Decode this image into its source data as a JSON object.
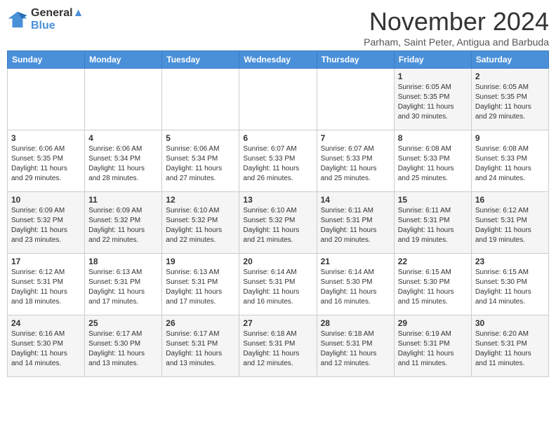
{
  "header": {
    "logo_line1": "General",
    "logo_line2": "Blue",
    "month": "November 2024",
    "location": "Parham, Saint Peter, Antigua and Barbuda"
  },
  "weekdays": [
    "Sunday",
    "Monday",
    "Tuesday",
    "Wednesday",
    "Thursday",
    "Friday",
    "Saturday"
  ],
  "weeks": [
    [
      {
        "day": "",
        "info": ""
      },
      {
        "day": "",
        "info": ""
      },
      {
        "day": "",
        "info": ""
      },
      {
        "day": "",
        "info": ""
      },
      {
        "day": "",
        "info": ""
      },
      {
        "day": "1",
        "info": "Sunrise: 6:05 AM\nSunset: 5:35 PM\nDaylight: 11 hours and 30 minutes."
      },
      {
        "day": "2",
        "info": "Sunrise: 6:05 AM\nSunset: 5:35 PM\nDaylight: 11 hours and 29 minutes."
      }
    ],
    [
      {
        "day": "3",
        "info": "Sunrise: 6:06 AM\nSunset: 5:35 PM\nDaylight: 11 hours and 29 minutes."
      },
      {
        "day": "4",
        "info": "Sunrise: 6:06 AM\nSunset: 5:34 PM\nDaylight: 11 hours and 28 minutes."
      },
      {
        "day": "5",
        "info": "Sunrise: 6:06 AM\nSunset: 5:34 PM\nDaylight: 11 hours and 27 minutes."
      },
      {
        "day": "6",
        "info": "Sunrise: 6:07 AM\nSunset: 5:33 PM\nDaylight: 11 hours and 26 minutes."
      },
      {
        "day": "7",
        "info": "Sunrise: 6:07 AM\nSunset: 5:33 PM\nDaylight: 11 hours and 25 minutes."
      },
      {
        "day": "8",
        "info": "Sunrise: 6:08 AM\nSunset: 5:33 PM\nDaylight: 11 hours and 25 minutes."
      },
      {
        "day": "9",
        "info": "Sunrise: 6:08 AM\nSunset: 5:33 PM\nDaylight: 11 hours and 24 minutes."
      }
    ],
    [
      {
        "day": "10",
        "info": "Sunrise: 6:09 AM\nSunset: 5:32 PM\nDaylight: 11 hours and 23 minutes."
      },
      {
        "day": "11",
        "info": "Sunrise: 6:09 AM\nSunset: 5:32 PM\nDaylight: 11 hours and 22 minutes."
      },
      {
        "day": "12",
        "info": "Sunrise: 6:10 AM\nSunset: 5:32 PM\nDaylight: 11 hours and 22 minutes."
      },
      {
        "day": "13",
        "info": "Sunrise: 6:10 AM\nSunset: 5:32 PM\nDaylight: 11 hours and 21 minutes."
      },
      {
        "day": "14",
        "info": "Sunrise: 6:11 AM\nSunset: 5:31 PM\nDaylight: 11 hours and 20 minutes."
      },
      {
        "day": "15",
        "info": "Sunrise: 6:11 AM\nSunset: 5:31 PM\nDaylight: 11 hours and 19 minutes."
      },
      {
        "day": "16",
        "info": "Sunrise: 6:12 AM\nSunset: 5:31 PM\nDaylight: 11 hours and 19 minutes."
      }
    ],
    [
      {
        "day": "17",
        "info": "Sunrise: 6:12 AM\nSunset: 5:31 PM\nDaylight: 11 hours and 18 minutes."
      },
      {
        "day": "18",
        "info": "Sunrise: 6:13 AM\nSunset: 5:31 PM\nDaylight: 11 hours and 17 minutes."
      },
      {
        "day": "19",
        "info": "Sunrise: 6:13 AM\nSunset: 5:31 PM\nDaylight: 11 hours and 17 minutes."
      },
      {
        "day": "20",
        "info": "Sunrise: 6:14 AM\nSunset: 5:31 PM\nDaylight: 11 hours and 16 minutes."
      },
      {
        "day": "21",
        "info": "Sunrise: 6:14 AM\nSunset: 5:30 PM\nDaylight: 11 hours and 16 minutes."
      },
      {
        "day": "22",
        "info": "Sunrise: 6:15 AM\nSunset: 5:30 PM\nDaylight: 11 hours and 15 minutes."
      },
      {
        "day": "23",
        "info": "Sunrise: 6:15 AM\nSunset: 5:30 PM\nDaylight: 11 hours and 14 minutes."
      }
    ],
    [
      {
        "day": "24",
        "info": "Sunrise: 6:16 AM\nSunset: 5:30 PM\nDaylight: 11 hours and 14 minutes."
      },
      {
        "day": "25",
        "info": "Sunrise: 6:17 AM\nSunset: 5:30 PM\nDaylight: 11 hours and 13 minutes."
      },
      {
        "day": "26",
        "info": "Sunrise: 6:17 AM\nSunset: 5:31 PM\nDaylight: 11 hours and 13 minutes."
      },
      {
        "day": "27",
        "info": "Sunrise: 6:18 AM\nSunset: 5:31 PM\nDaylight: 11 hours and 12 minutes."
      },
      {
        "day": "28",
        "info": "Sunrise: 6:18 AM\nSunset: 5:31 PM\nDaylight: 11 hours and 12 minutes."
      },
      {
        "day": "29",
        "info": "Sunrise: 6:19 AM\nSunset: 5:31 PM\nDaylight: 11 hours and 11 minutes."
      },
      {
        "day": "30",
        "info": "Sunrise: 6:20 AM\nSunset: 5:31 PM\nDaylight: 11 hours and 11 minutes."
      }
    ]
  ]
}
